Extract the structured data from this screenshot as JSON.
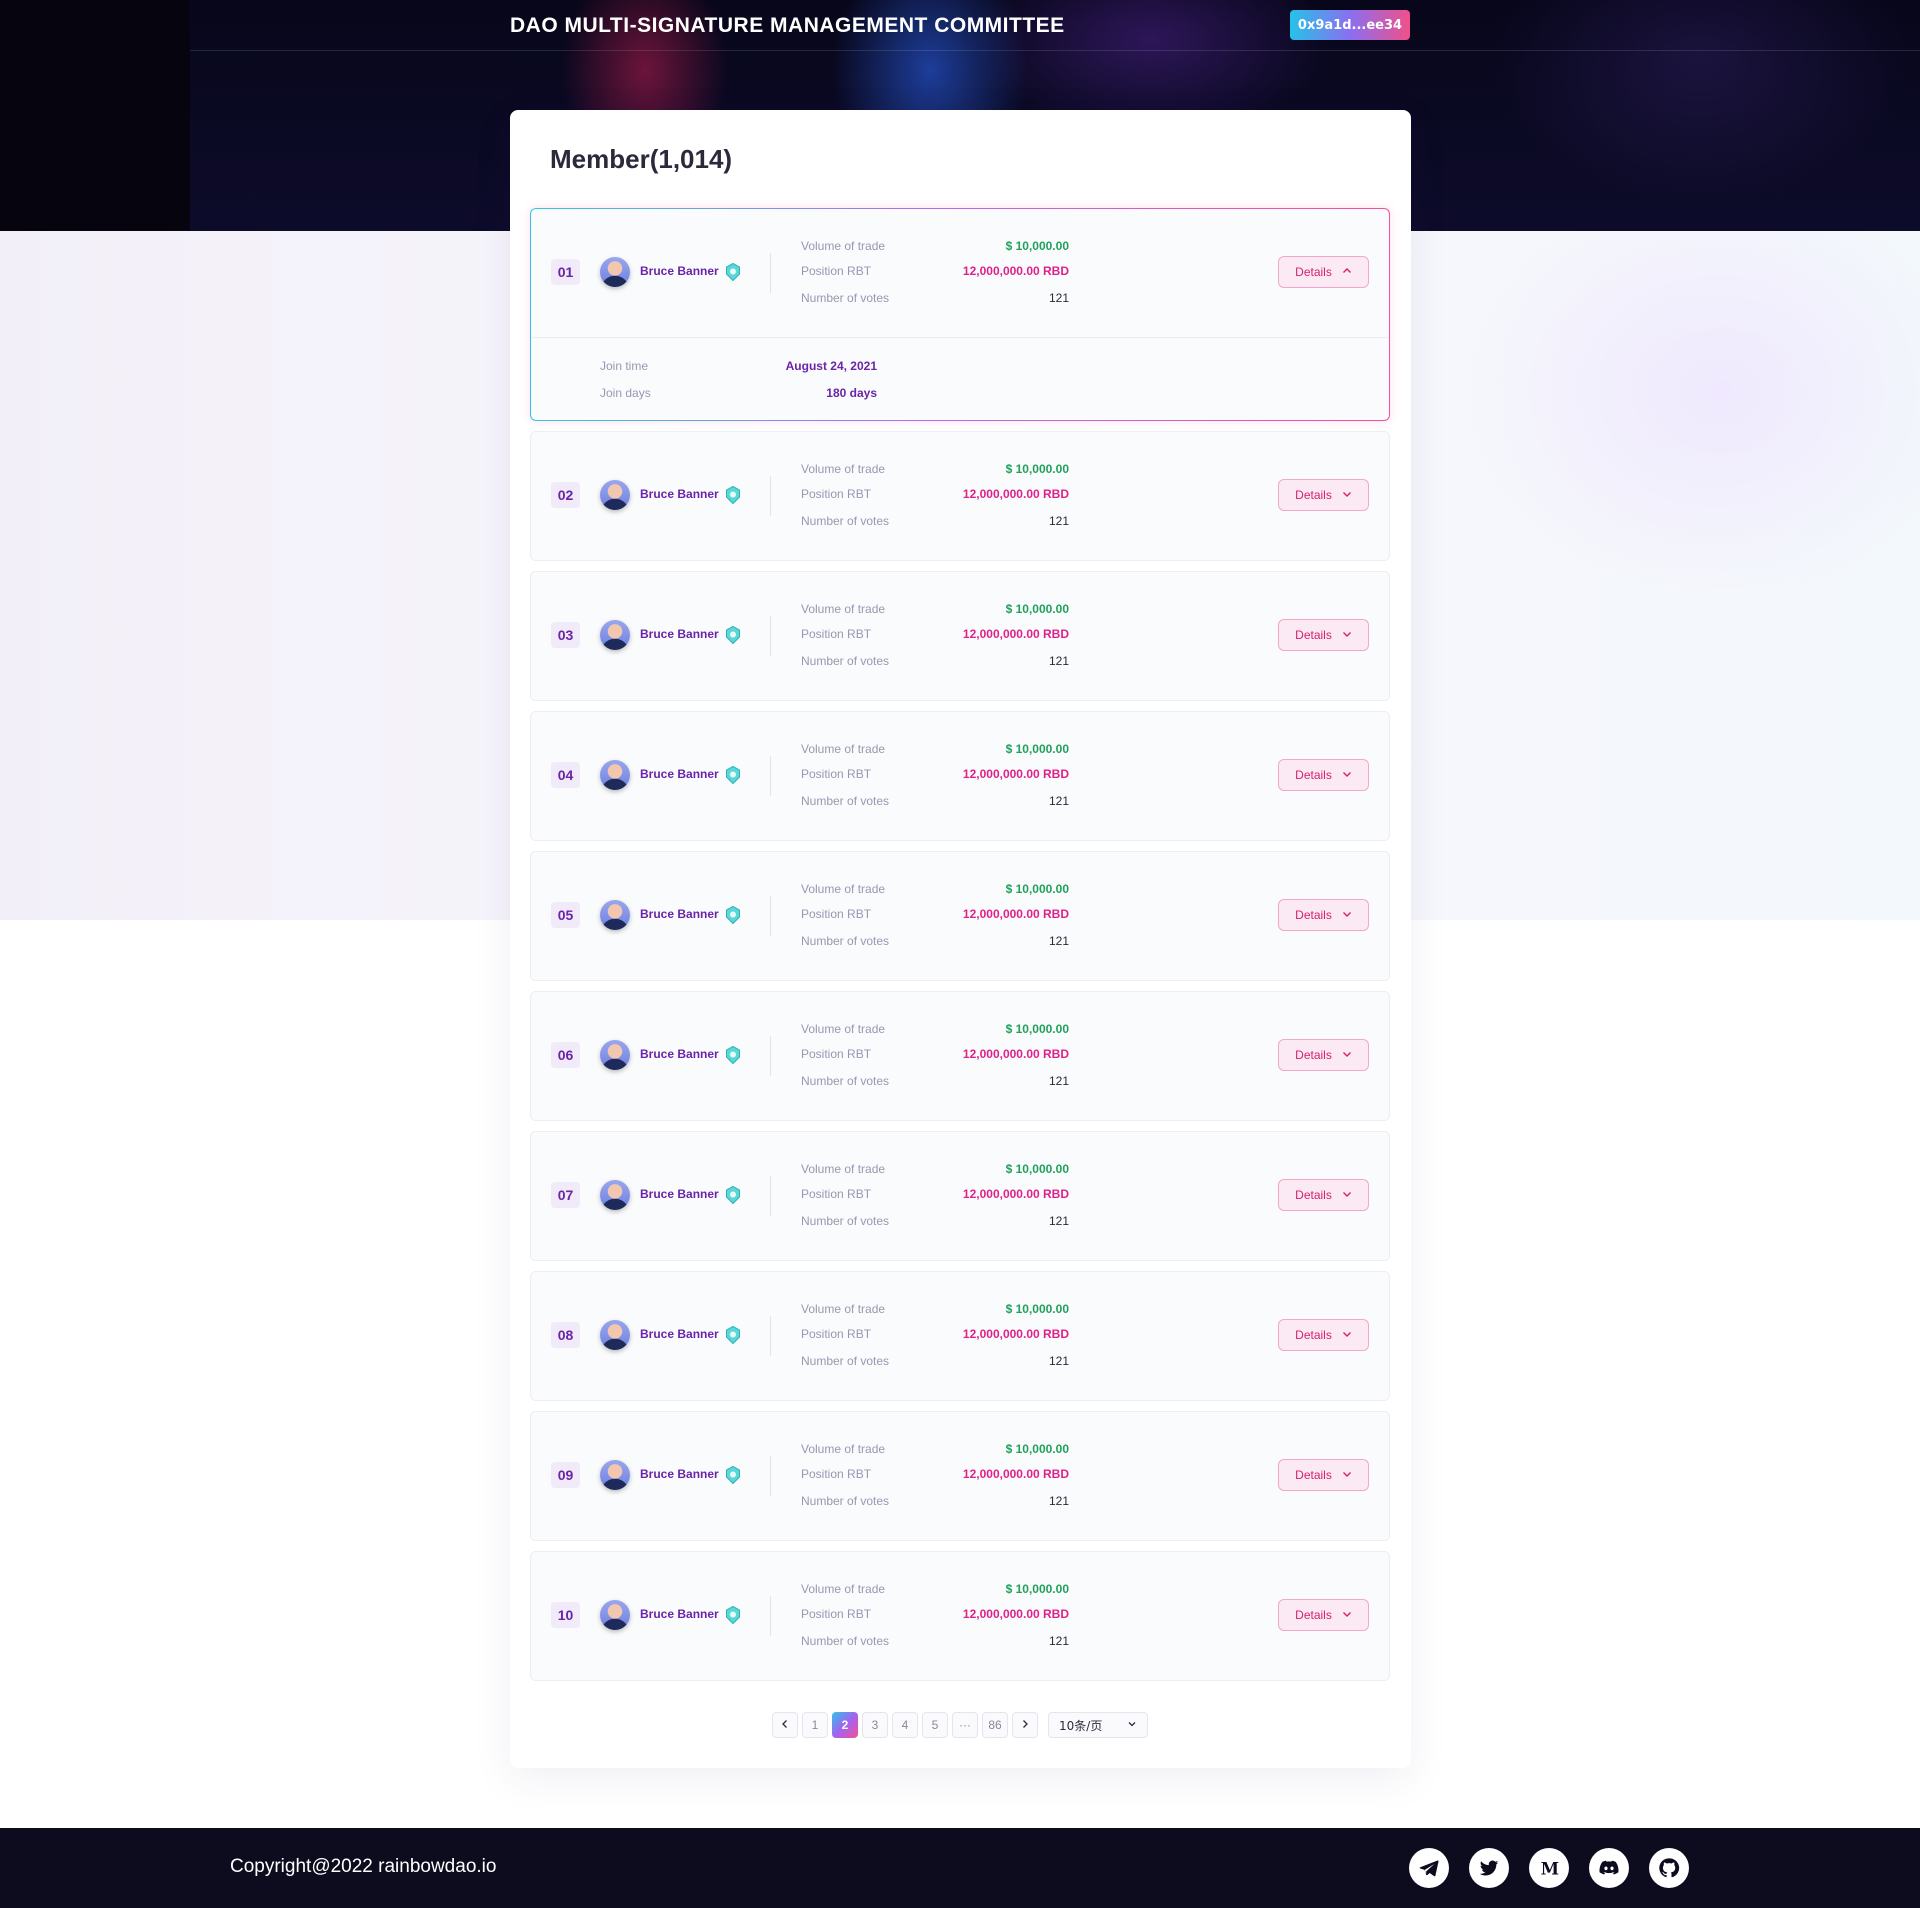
{
  "header": {
    "title": "DAO MULTI-SIGNATURE MANAGEMENT COMMITTEE",
    "wallet": "0x9a1d...ee34"
  },
  "panel": {
    "title": "Member(1,014)"
  },
  "labels": {
    "volume": "Volume of trade",
    "position": "Position RBT",
    "votes": "Number of votes",
    "details": "Details",
    "join_time": "Join time",
    "join_days": "Join days"
  },
  "members": [
    {
      "rank": "01",
      "name": "Bruce Banner",
      "volume": "$ 10,000.00",
      "position": "12,000,000.00 RBD",
      "votes": "121",
      "expanded": true,
      "join_time": "August 24, 2021",
      "join_days": "180 days"
    },
    {
      "rank": "02",
      "name": "Bruce Banner",
      "volume": "$ 10,000.00",
      "position": "12,000,000.00 RBD",
      "votes": "121"
    },
    {
      "rank": "03",
      "name": "Bruce Banner",
      "volume": "$ 10,000.00",
      "position": "12,000,000.00 RBD",
      "votes": "121"
    },
    {
      "rank": "04",
      "name": "Bruce Banner",
      "volume": "$ 10,000.00",
      "position": "12,000,000.00 RBD",
      "votes": "121"
    },
    {
      "rank": "05",
      "name": "Bruce Banner",
      "volume": "$ 10,000.00",
      "position": "12,000,000.00 RBD",
      "votes": "121"
    },
    {
      "rank": "06",
      "name": "Bruce Banner",
      "volume": "$ 10,000.00",
      "position": "12,000,000.00 RBD",
      "votes": "121"
    },
    {
      "rank": "07",
      "name": "Bruce Banner",
      "volume": "$ 10,000.00",
      "position": "12,000,000.00 RBD",
      "votes": "121"
    },
    {
      "rank": "08",
      "name": "Bruce Banner",
      "volume": "$ 10,000.00",
      "position": "12,000,000.00 RBD",
      "votes": "121"
    },
    {
      "rank": "09",
      "name": "Bruce Banner",
      "volume": "$ 10,000.00",
      "position": "12,000,000.00 RBD",
      "votes": "121"
    },
    {
      "rank": "10",
      "name": "Bruce Banner",
      "volume": "$ 10,000.00",
      "position": "12,000,000.00 RBD",
      "votes": "121"
    }
  ],
  "pagination": {
    "pages": [
      "1",
      "2",
      "3",
      "4",
      "5",
      "···",
      "86"
    ],
    "current": "2",
    "page_size": "10条/页"
  },
  "footer": {
    "copyright": "Copyright@2022 rainbowdao.io",
    "socials": [
      "telegram-icon",
      "twitter-icon",
      "medium-icon",
      "discord-icon",
      "github-icon"
    ]
  },
  "colors": {
    "accent_purple": "#6a24a8",
    "trade_green": "#20a05a",
    "position_pink": "#e0208a",
    "details_pink": "#d6206e"
  }
}
